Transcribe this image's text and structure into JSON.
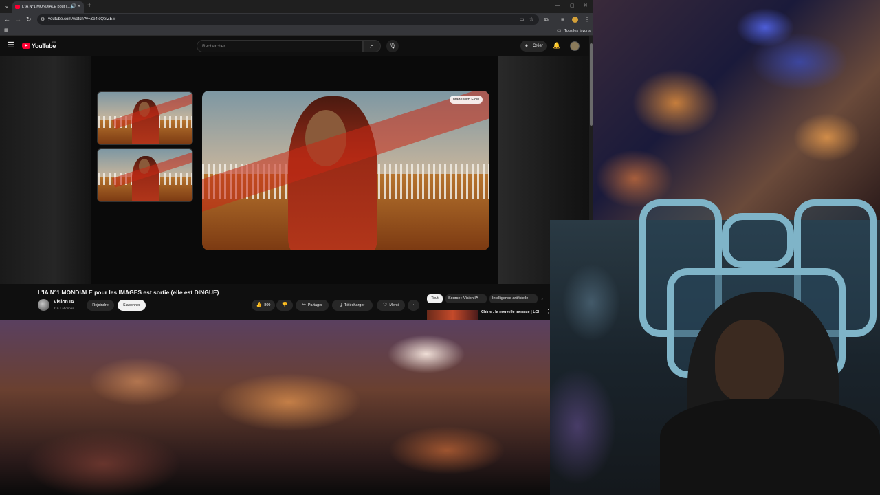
{
  "browser": {
    "tab": {
      "title": "L'IA N°1 MONDIALE pour l..."
    },
    "url": "youtube.com/watch?v=Ze4lcQeIZEM",
    "bookmarks": {
      "all_favorites": "Tous les favoris"
    }
  },
  "youtube": {
    "logo_text": "YouTube",
    "country_code": "FR",
    "search_placeholder": "Rechercher",
    "create_label": "Créer",
    "player_badge": "Made with Flow",
    "video_title": "L'IA N°1 MONDIALE pour les IMAGES est sortie (elle est DINGUE)",
    "channel": {
      "name": "Vision IA",
      "subscribers": "216 k abonnés",
      "join_label": "Rejoindre",
      "subscribe_label": "S'abonner"
    },
    "actions": {
      "like_count": "809",
      "share_label": "Partager",
      "download_label": "Télécharger",
      "thanks_label": "Merci"
    },
    "chips": [
      "Tout",
      "Source : Vision IA",
      "Intelligence artificielle"
    ],
    "recommended": {
      "title": "Chine : la nouvelle menace | LCI"
    }
  },
  "colors": {
    "yt_red": "#ff0033",
    "page_bg": "#0f0f0f",
    "browser_chrome": "#35363a"
  }
}
